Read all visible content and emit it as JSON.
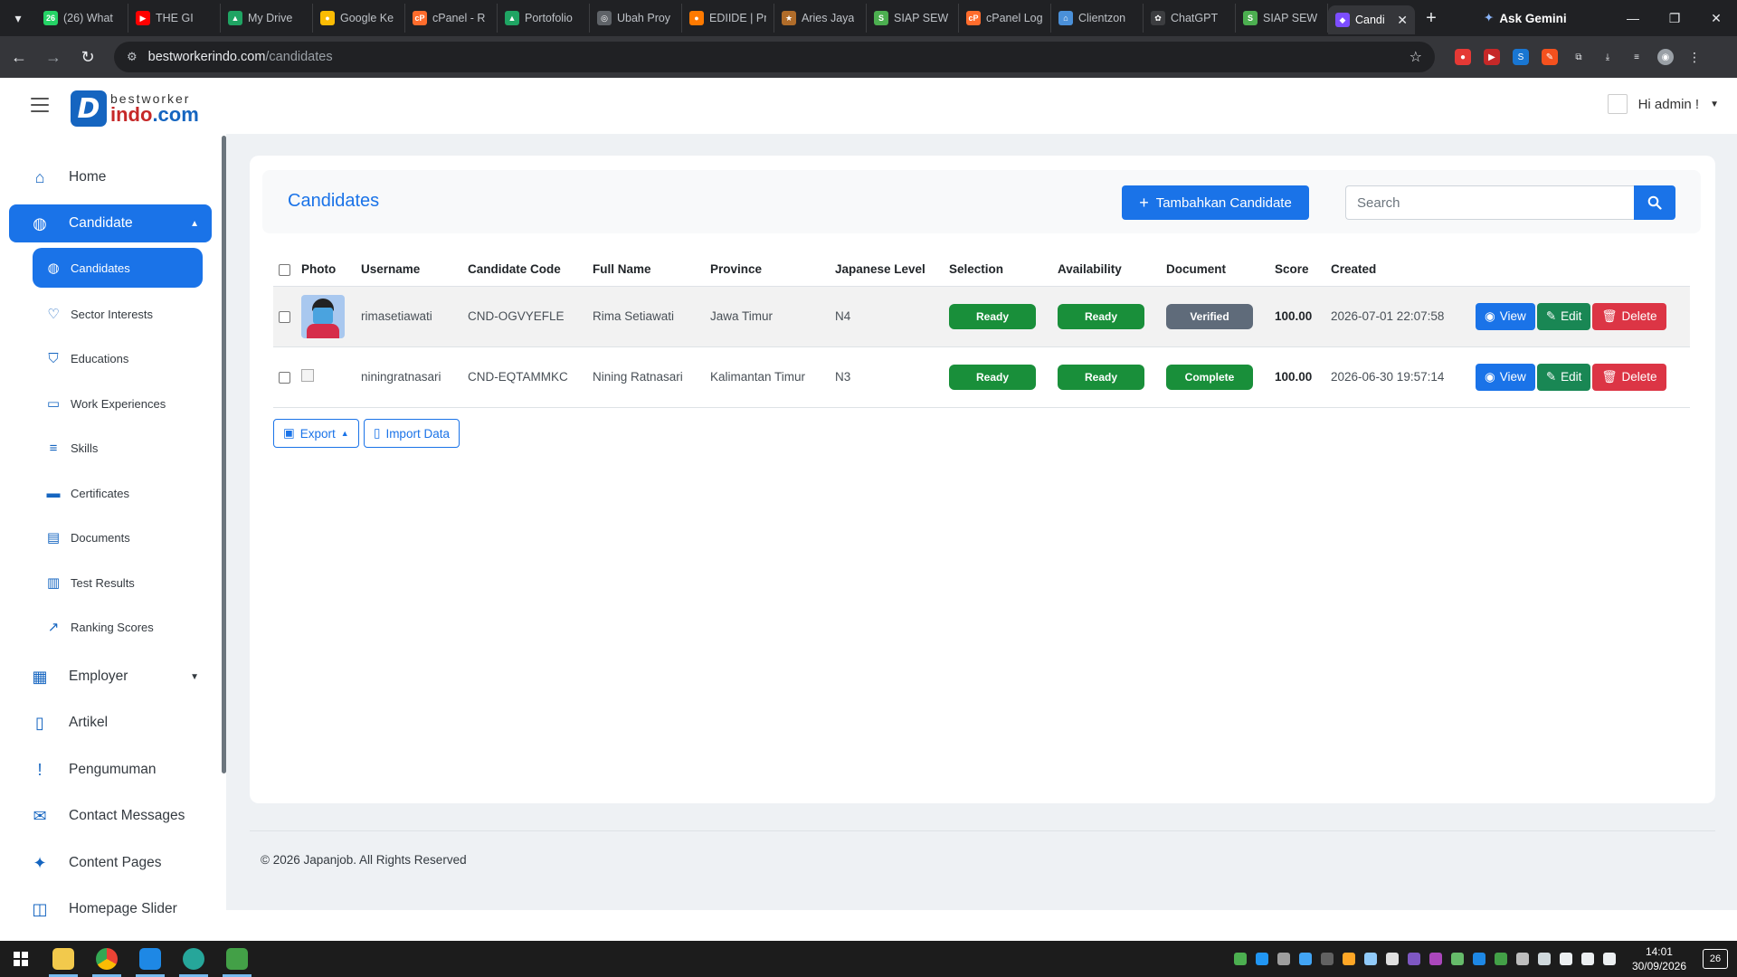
{
  "browser": {
    "tabs": [
      {
        "title": "(26) What",
        "fav_color": "#25d366",
        "fav_text": "26"
      },
      {
        "title": "THE GI",
        "fav_color": "#ff0000",
        "fav_text": "▶"
      },
      {
        "title": "My Drive",
        "fav_color": "#1fa463",
        "fav_text": "▲"
      },
      {
        "title": "Google Ke",
        "fav_color": "#fbbc04",
        "fav_text": "●"
      },
      {
        "title": "cPanel - R",
        "fav_color": "#ff6c2c",
        "fav_text": "cP"
      },
      {
        "title": "Portofolio",
        "fav_color": "#1fa463",
        "fav_text": "▲"
      },
      {
        "title": "Ubah Proy",
        "fav_color": "#5f6368",
        "fav_text": "◎"
      },
      {
        "title": "EDIIDE | Pr",
        "fav_color": "#ff7a00",
        "fav_text": "●"
      },
      {
        "title": "Aries Jaya",
        "fav_color": "#b06c2a",
        "fav_text": "★"
      },
      {
        "title": "SIAP SEW",
        "fav_color": "#4caf50",
        "fav_text": "S"
      },
      {
        "title": "cPanel Log",
        "fav_color": "#ff6c2c",
        "fav_text": "cP"
      },
      {
        "title": "Clientzon",
        "fav_color": "#4a90d9",
        "fav_text": "⌂"
      },
      {
        "title": "ChatGPT",
        "fav_color": "#3c3d40",
        "fav_text": "✿"
      },
      {
        "title": "SIAP SEW",
        "fav_color": "#4caf50",
        "fav_text": "S"
      }
    ],
    "active_tab": {
      "title": "Candi",
      "fav_color": "#7c4dff",
      "fav_text": "◆"
    },
    "ask_gemini": "Ask Gemini",
    "url_host": "bestworkerindo.com",
    "url_path": "/candidates"
  },
  "header": {
    "logo_top": "bestworker",
    "logo_bottom_a": "indo",
    "logo_bottom_b": ".com",
    "greeting": "Hi admin !"
  },
  "sidebar": {
    "home": "Home",
    "candidate": "Candidate",
    "sub": {
      "candidates": "Candidates",
      "sector_interests": "Sector Interests",
      "educations": "Educations",
      "work_experiences": "Work Experiences",
      "skills": "Skills",
      "certificates": "Certificates",
      "documents": "Documents",
      "test_results": "Test Results",
      "ranking_scores": "Ranking Scores"
    },
    "employer": "Employer",
    "artikel": "Artikel",
    "pengumuman": "Pengumuman",
    "contact_messages": "Contact Messages",
    "content_pages": "Content Pages",
    "homepage_slider": "Homepage Slider"
  },
  "page": {
    "title": "Candidates",
    "add_button": "Tambahkan Candidate",
    "search_placeholder": "Search",
    "columns": [
      "Photo",
      "Username",
      "Candidate Code",
      "Full Name",
      "Province",
      "Japanese Level",
      "Selection",
      "Availability",
      "Document",
      "Score",
      "Created"
    ],
    "rows": [
      {
        "username": "rimasetiawati",
        "code": "CND-OGVYEFLE",
        "full_name": "Rima Setiawati",
        "province": "Jawa Timur",
        "jlpt": "N4",
        "selection": "Ready",
        "availability": "Ready",
        "document": "Verified",
        "document_color": "#5f6b7a",
        "score": "100.00",
        "created": "2026-07-01 22:07:58"
      },
      {
        "username": "niningratnasari",
        "code": "CND-EQTAMMKC",
        "full_name": "Nining Ratnasari",
        "province": "Kalimantan Timur",
        "jlpt": "N3",
        "selection": "Ready",
        "availability": "Ready",
        "document": "Complete",
        "document_color": "#198f3a",
        "score": "100.00",
        "created": "2026-06-30 19:57:14"
      }
    ],
    "actions": {
      "view": "View",
      "edit": "Edit",
      "delete": "Delete"
    },
    "export_button": "Export",
    "import_button": "Import Data",
    "footer": "© 2026 Japanjob. All Rights Reserved"
  },
  "taskbar": {
    "time": "14:01",
    "date": "30/09/2026",
    "notifications": "26"
  },
  "colors": {
    "primary": "#1a73e8",
    "success": "#198754",
    "danger": "#dc3545",
    "badge_green": "#198f3a",
    "badge_gray": "#5f6b7a"
  }
}
